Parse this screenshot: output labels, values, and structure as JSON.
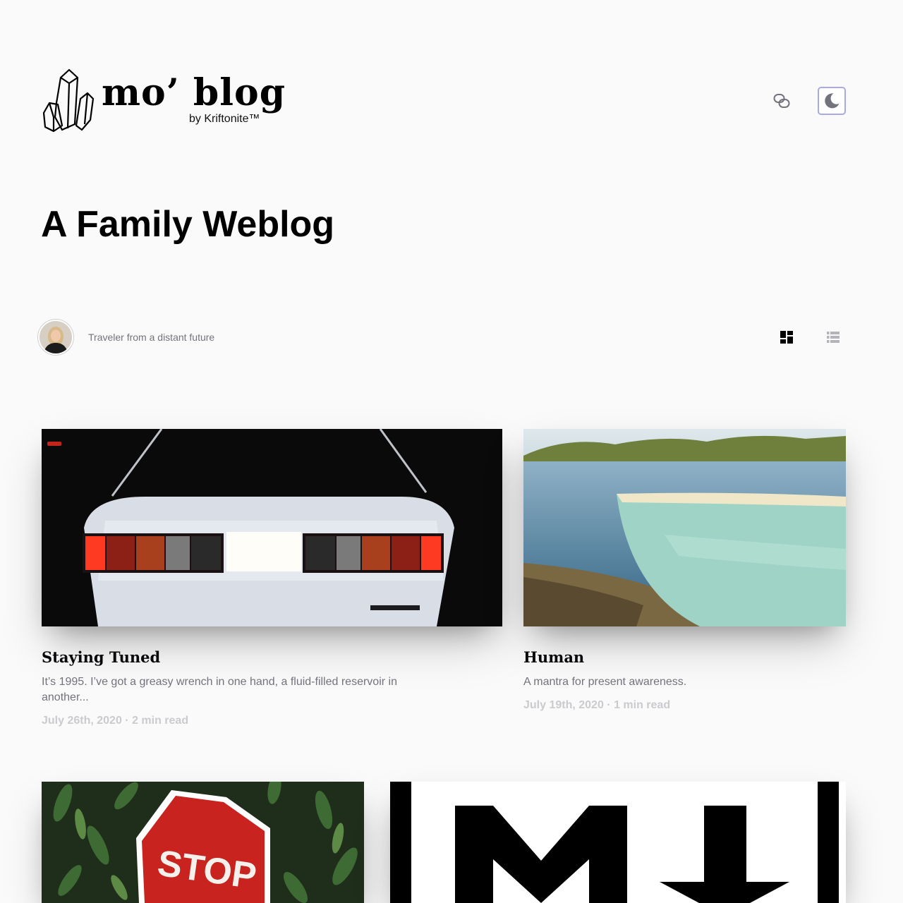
{
  "header": {
    "logo_wordmark": "mo’ blog",
    "logo_tagline": "by Kriftonite™",
    "share_icon": "link-icon",
    "theme_icon": "moon-icon"
  },
  "hero": {
    "title": "A Family Weblog"
  },
  "author": {
    "bio": "Traveler from a distant future",
    "avatar_icon": "avatar"
  },
  "layout_toggle": {
    "grid_icon": "grid-layout-icon",
    "rows_icon": "rows-layout-icon"
  },
  "articles": [
    {
      "title": "Staying Tuned",
      "excerpt": "It’s 1995. I’ve got a greasy wrench in one hand, a fluid-filled reservoir in another...",
      "meta": "July 26th, 2020 · 2 min read",
      "image": "car-taillights-photo"
    },
    {
      "title": "Human",
      "excerpt": "A mantra for present awareness.",
      "meta": "July 19th, 2020 · 1 min read",
      "image": "canoe-lake-photo"
    },
    {
      "title": "",
      "image": "stop-sign-photo",
      "sign_text": "STOP"
    },
    {
      "title": "",
      "image": "markdown-logo-image",
      "logo_letter": "M"
    }
  ],
  "colors": {
    "background": "#fafafa",
    "accent_border": "#a9a9e6",
    "secondary_text": "#73737d",
    "meta_text": "#cbcbcf"
  }
}
